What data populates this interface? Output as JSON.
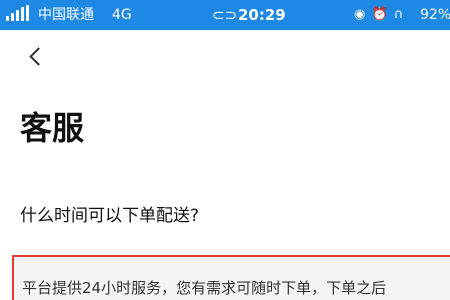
{
  "status_bar": {
    "carrier": "中国联通",
    "network": "4G",
    "time": "20:29",
    "icons": [
      "link-icon",
      "location-icon",
      "alarm-icon",
      "headphones-icon"
    ],
    "battery": "92%",
    "background": "#1e88e5"
  },
  "header": {
    "back_icon": "chevron-left-icon"
  },
  "page": {
    "title": "客服"
  },
  "faq": {
    "question": "什么时间可以下单配送?",
    "answer": "平台提供24小时服务，您有需求可随时下单，下单之后"
  },
  "colors": {
    "highlight_border": "#e53935"
  }
}
